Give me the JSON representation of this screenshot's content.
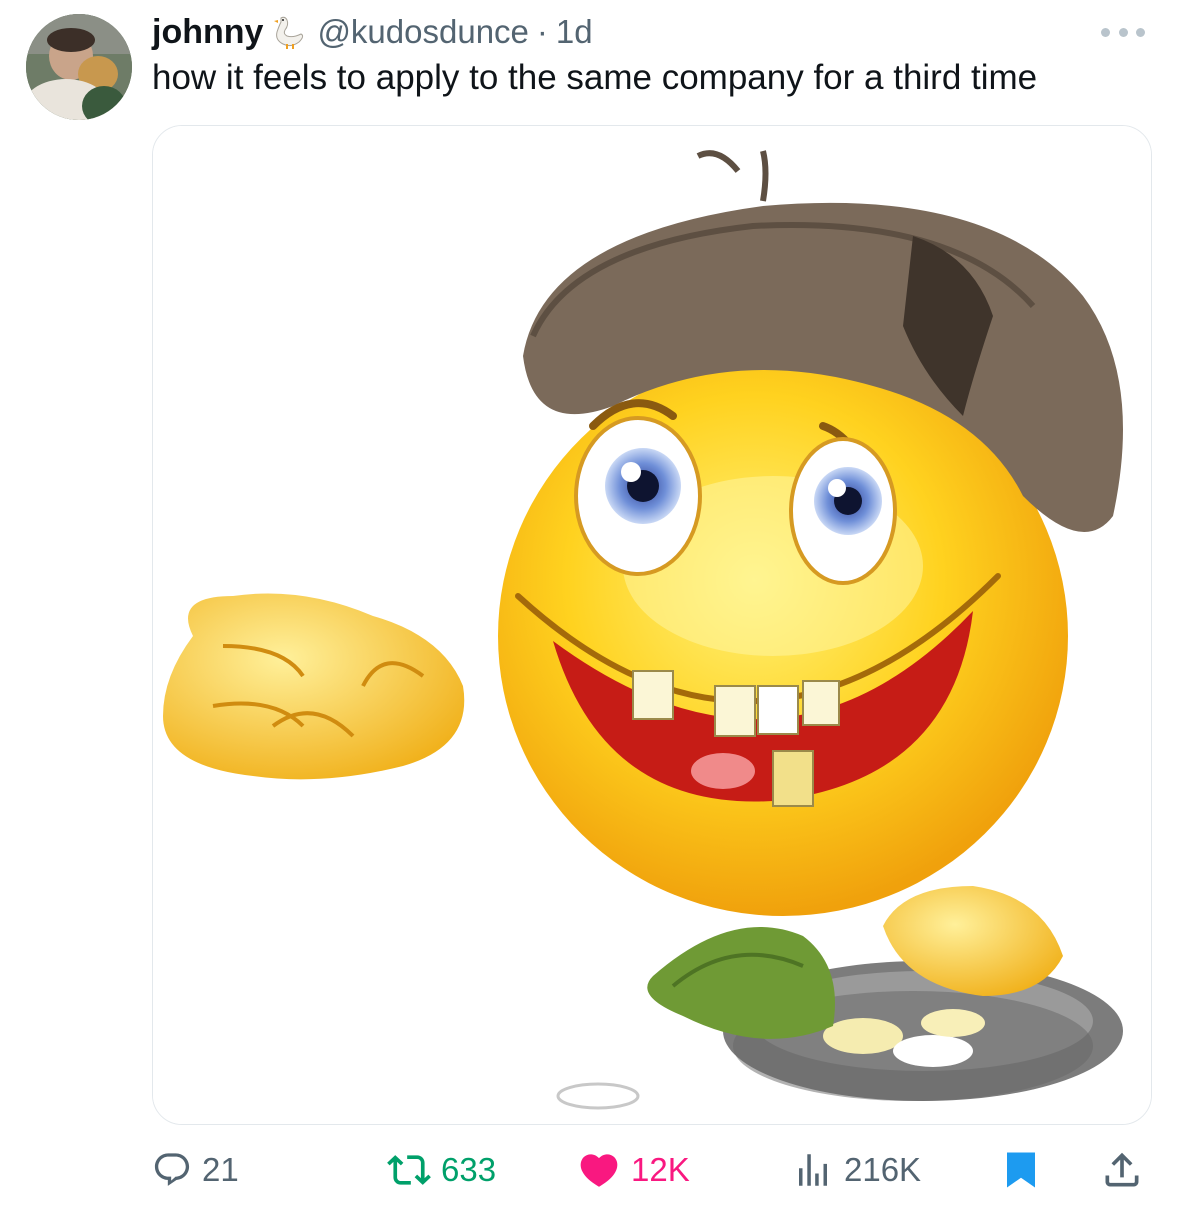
{
  "tweet": {
    "display_name": "johnny",
    "badge_icon": "goose-emoji-icon",
    "handle": "@kudosdunce",
    "separator": "·",
    "time": "1d",
    "text": "how it feels to apply to the same company for a third time",
    "media_description_icon": "beggar-smiley-emoji-image"
  },
  "actions": {
    "reply": {
      "icon": "reply-icon",
      "count": "21"
    },
    "retweet": {
      "icon": "retweet-icon",
      "count": "633",
      "color": "#00a06a"
    },
    "like": {
      "icon": "heart-filled-icon",
      "count": "12K",
      "color": "#f91880"
    },
    "views": {
      "icon": "analytics-icon",
      "count": "216K"
    },
    "bookmark": {
      "icon": "bookmark-filled-icon",
      "color": "#1d9bf0"
    },
    "share": {
      "icon": "share-icon"
    }
  }
}
